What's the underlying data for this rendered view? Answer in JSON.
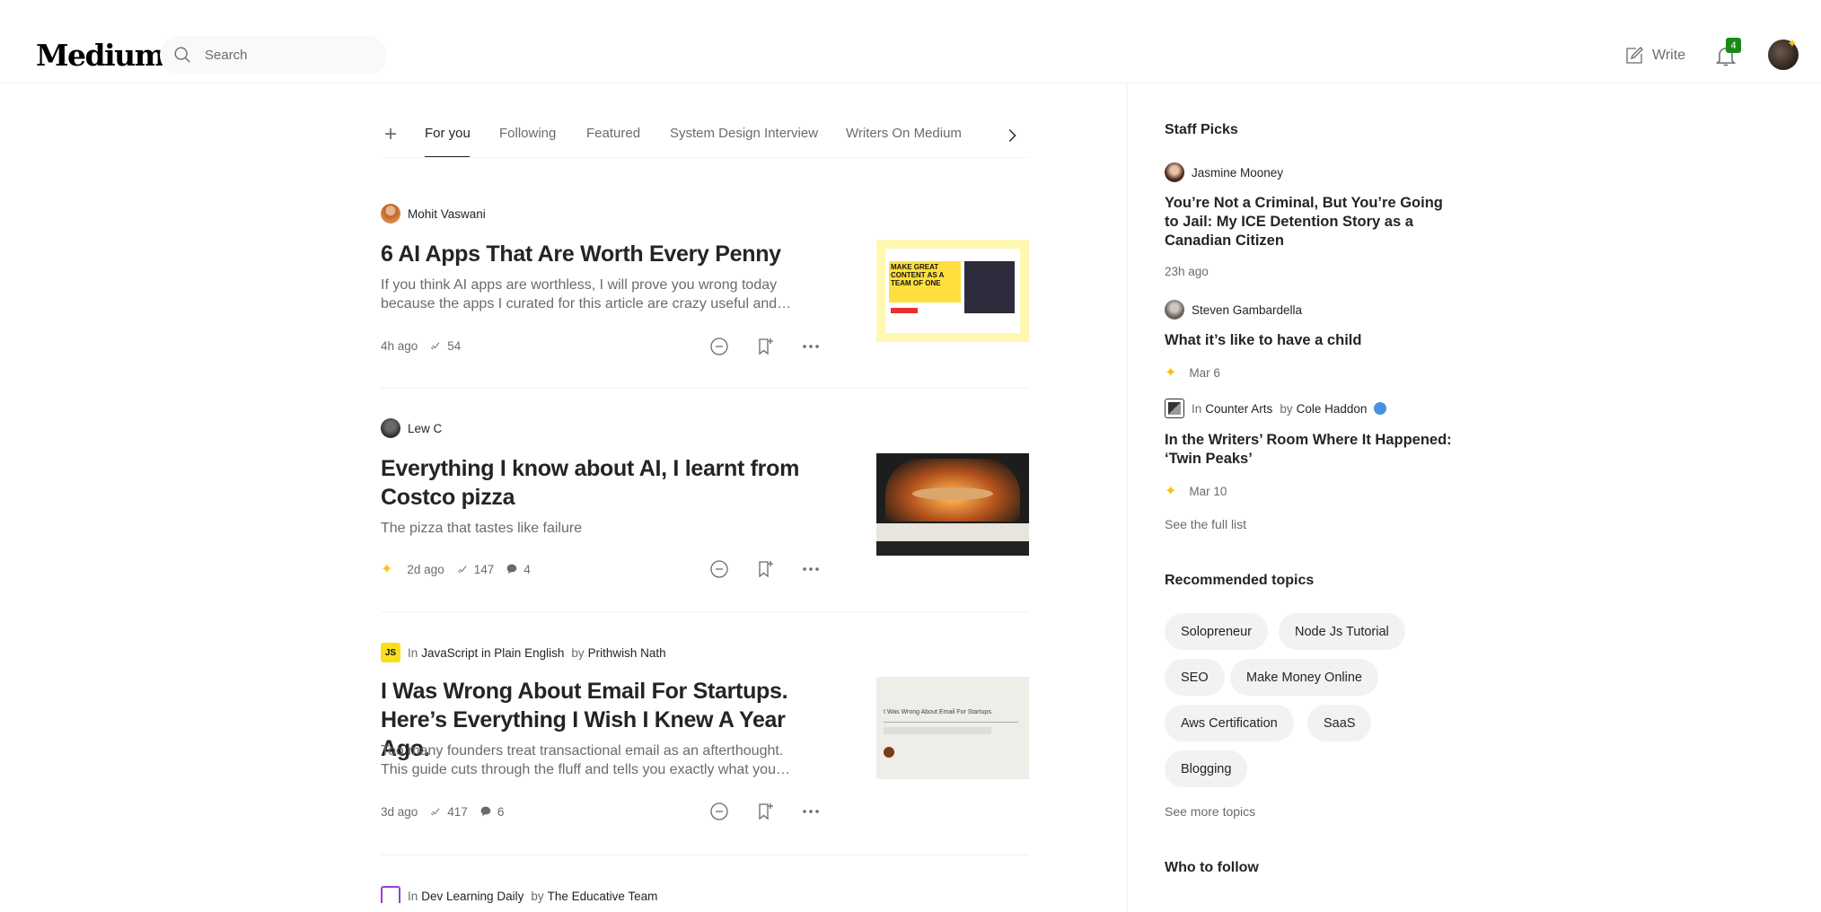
{
  "header": {
    "logo": "Medium",
    "search_placeholder": "Search",
    "write_label": "Write",
    "notification_count": "4"
  },
  "tabs": [
    {
      "label": "For you",
      "active": true
    },
    {
      "label": "Following"
    },
    {
      "label": "Featured"
    },
    {
      "label": "System Design Interview"
    },
    {
      "label": "Writers On Medium"
    }
  ],
  "articles": [
    {
      "author": "Mohit Vaswani",
      "title": "6 AI Apps That Are Worth Every Penny",
      "subtitle": "If you think AI apps are worthless, I will prove you wrong today because the apps I curated for this article are crazy useful and…",
      "time": "4h ago",
      "claps": "54"
    },
    {
      "author": "Lew C",
      "title": "Everything I know about AI, I learnt from Costco pizza",
      "subtitle": "The pizza that tastes like failure",
      "time": "2d ago",
      "claps": "147",
      "comments": "4"
    },
    {
      "in_label": "In",
      "publication": "JavaScript in Plain English",
      "by_label": "by",
      "author": "Prithwish Nath",
      "title": "I Was Wrong About Email For Startups. Here’s Everything I Wish I Knew A Year Ago.",
      "subtitle": "Too many founders treat transactional email as an afterthought. This guide cuts through the fluff and tells you exactly what you…",
      "time": "3d ago",
      "claps": "417",
      "comments": "6",
      "thumb_text": "I Was Wrong About Email For Startups.",
      "pub_icon_text": "JS"
    },
    {
      "in_label": "In",
      "publication": "Dev Learning Daily",
      "by_label": "by",
      "author": "The Educative Team"
    }
  ],
  "thumb1_text": "MAKE GREAT CONTENT AS A TEAM OF ONE",
  "staff_picks": {
    "heading": "Staff Picks",
    "items": [
      {
        "author": "Jasmine Mooney",
        "title": "You’re Not a Criminal, But You’re Going to Jail: My ICE Detention Story as a Canadian Citizen",
        "date": "23h ago"
      },
      {
        "author": "Steven Gambardella",
        "title": "What it’s like to have a child",
        "date": "Mar 6"
      },
      {
        "in_label": "In",
        "publication": "Counter Arts",
        "by_label": "by",
        "author": "Cole Haddon",
        "title": "In the Writers’ Room Where It Happened: ‘Twin Peaks’",
        "date": "Mar 10"
      }
    ],
    "see_full": "See the full list"
  },
  "recommended": {
    "heading": "Recommended topics",
    "topics": [
      "Solopreneur",
      "Node Js Tutorial",
      "SEO",
      "Make Money Online",
      "Aws Certification",
      "SaaS",
      "Blogging"
    ],
    "see_more": "See more topics"
  },
  "who_to_follow": "Who to follow",
  "colors": {
    "text": "#242424",
    "muted": "#6b6b6b",
    "member_star": "#ffc017",
    "notification_badge": "#1a8917"
  }
}
